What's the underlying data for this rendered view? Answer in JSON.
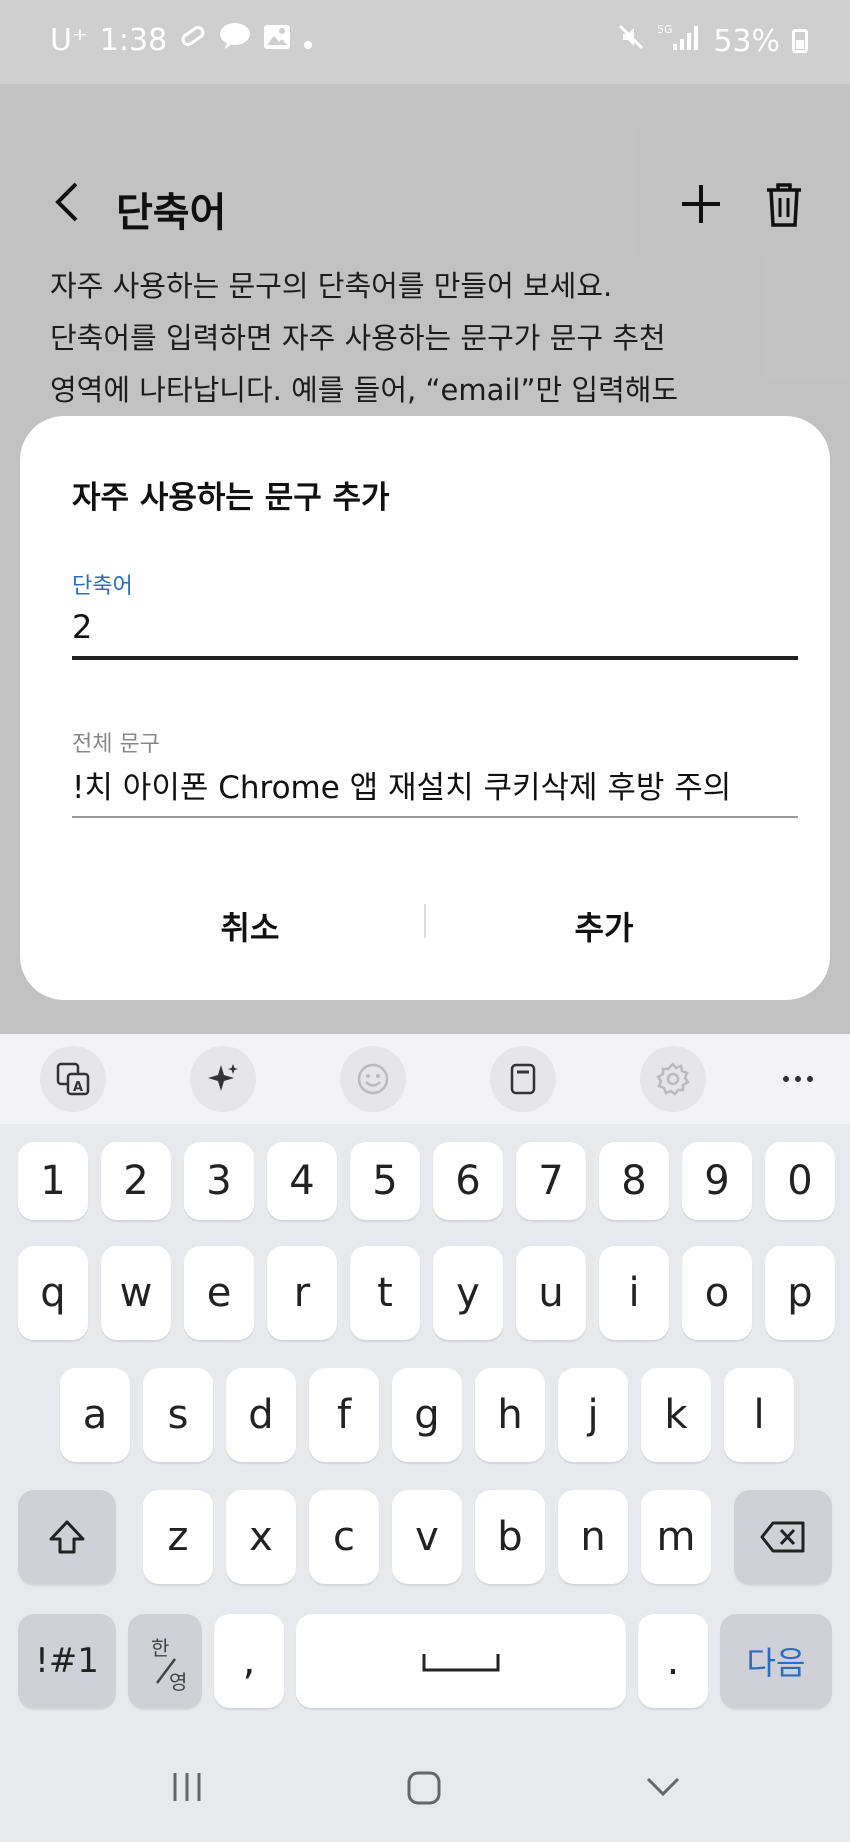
{
  "status_bar": {
    "carrier": "U⁺",
    "time": "1:38",
    "battery": "53%",
    "net": "5G"
  },
  "app_bar": {
    "title": "단축어"
  },
  "description": {
    "line1": "자주 사용하는 문구의 단축어를 만들어 보세요.",
    "line2": "단축어를 입력하면 자주 사용하는 문구가 문구 추천",
    "line3": "영역에 나타납니다. 예를 들어, “email”만 입력해도"
  },
  "dialog": {
    "title": "자주 사용하는 문구 추가",
    "shortcut_label": "단축어",
    "shortcut_value": "2",
    "phrase_label": "전체 문구",
    "phrase_value": "!치  아이폰 Chrome 앱 재설치  쿠키삭제 후방 주의",
    "cancel_label": "취소",
    "add_label": "추가"
  },
  "keyboard": {
    "number_row": [
      "1",
      "2",
      "3",
      "4",
      "5",
      "6",
      "7",
      "8",
      "9",
      "0"
    ],
    "row1": [
      "q",
      "w",
      "e",
      "r",
      "t",
      "y",
      "u",
      "i",
      "o",
      "p"
    ],
    "row2": [
      "a",
      "s",
      "d",
      "f",
      "g",
      "h",
      "j",
      "k",
      "l"
    ],
    "row3": [
      "z",
      "x",
      "c",
      "v",
      "b",
      "n",
      "m"
    ],
    "symbols_label": "!#1",
    "lang_top": "한",
    "lang_bottom": "영",
    "comma": ",",
    "period": ".",
    "next_label": "다음"
  }
}
